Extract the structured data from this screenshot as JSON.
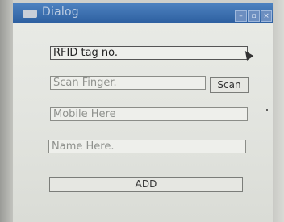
{
  "window": {
    "title": "Dialog",
    "controls": {
      "minimize": "–",
      "maximize": "▫",
      "close": "×"
    }
  },
  "form": {
    "rfid": {
      "value": "RFID tag no."
    },
    "finger": {
      "placeholder": "Scan Finger.",
      "button": "Scan"
    },
    "mobile": {
      "placeholder": "Mobile Here"
    },
    "name": {
      "placeholder": "Name Here."
    },
    "add_button": "ADD"
  }
}
